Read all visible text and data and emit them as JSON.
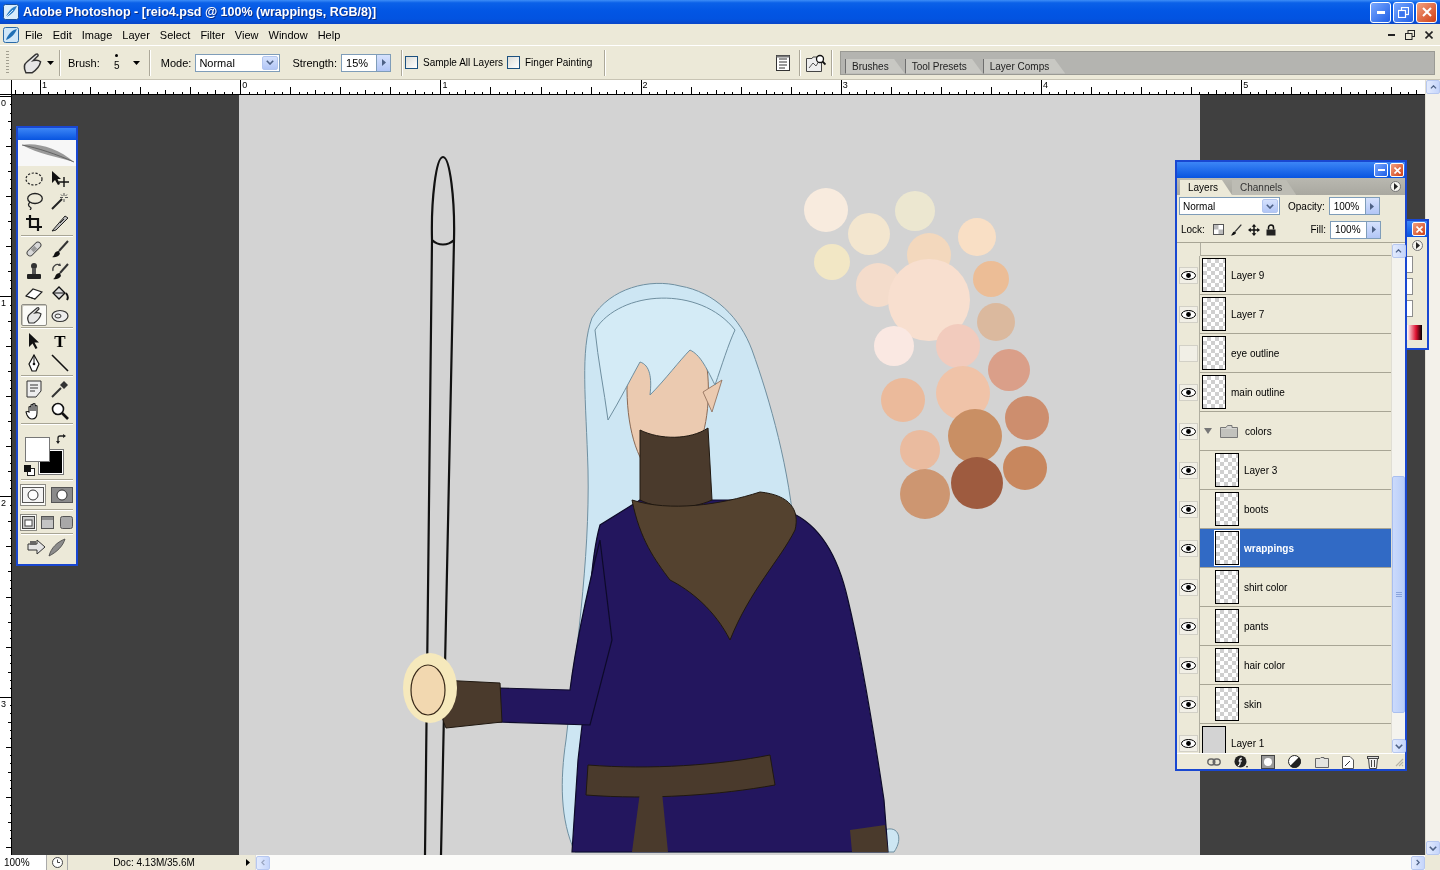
{
  "window": {
    "title": "Adobe Photoshop - [reio4.psd @ 100% (wrappings, RGB/8)]"
  },
  "menu_bar": {
    "items": [
      "File",
      "Edit",
      "Image",
      "Layer",
      "Select",
      "Filter",
      "View",
      "Window",
      "Help"
    ]
  },
  "options_bar": {
    "brush_label": "Brush:",
    "brush_size": "5",
    "mode_label": "Mode:",
    "mode": "Normal",
    "strength_label": "Strength:",
    "strength": "15%",
    "checkboxes": [
      {
        "label": "Sample All Layers",
        "checked": false
      },
      {
        "label": "Finger Painting",
        "checked": false
      }
    ],
    "palette_well_tabs": [
      "Brushes",
      "Tool Presets",
      "Layer Comps"
    ]
  },
  "rulers": {
    "horizontal": [
      "1",
      "0",
      "1",
      "2",
      "3",
      "4",
      "5"
    ],
    "vertical": [
      "0",
      "1",
      "2",
      "3"
    ]
  },
  "toolbox": {
    "tool_groups": [
      [
        {
          "kind": "marquee",
          "selected": false
        },
        {
          "kind": "move",
          "selected": false
        },
        {
          "kind": "lasso",
          "selected": false
        },
        {
          "kind": "magic_wand",
          "selected": false
        },
        {
          "kind": "crop",
          "selected": false
        },
        {
          "kind": "slice",
          "selected": false
        }
      ],
      [
        {
          "kind": "healing_brush",
          "selected": false
        },
        {
          "kind": "brush",
          "selected": false
        },
        {
          "kind": "clone_stamp",
          "selected": false
        },
        {
          "kind": "history_brush",
          "selected": false
        },
        {
          "kind": "eraser",
          "selected": false
        },
        {
          "kind": "paint_bucket",
          "selected": false
        },
        {
          "kind": "smudge",
          "selected": true
        },
        {
          "kind": "sponge",
          "selected": false
        }
      ],
      [
        {
          "kind": "path_selection",
          "selected": false
        },
        {
          "kind": "type",
          "glyph": "T",
          "selected": false
        },
        {
          "kind": "pen",
          "selected": false
        },
        {
          "kind": "line",
          "selected": false
        }
      ],
      [
        {
          "kind": "notes",
          "selected": false
        },
        {
          "kind": "eyedropper",
          "selected": false
        },
        {
          "kind": "hand",
          "selected": false
        },
        {
          "kind": "zoom",
          "selected": false
        }
      ]
    ],
    "mask_modes": [
      {
        "kind": "standard",
        "selected": true
      },
      {
        "kind": "quick_mask",
        "selected": false
      }
    ],
    "screen_modes": [
      {
        "kind": "standard",
        "selected": true
      },
      {
        "kind": "full_with_menu",
        "selected": false
      },
      {
        "kind": "full",
        "selected": false
      }
    ]
  },
  "canvas": {
    "paint_dabs": [
      {
        "color": "#f8ebde"
      },
      {
        "color": "#f3e6cf"
      },
      {
        "color": "#ece7d0"
      },
      {
        "color": "#f2e7c5"
      },
      {
        "color": "#f9dfc5"
      },
      {
        "color": "#f3d8bd"
      },
      {
        "color": "#f4dccb"
      },
      {
        "color": "#ecbd96"
      },
      {
        "color": "#f8dfcf"
      },
      {
        "color": "#dbb99e"
      },
      {
        "color": "#fae8e2"
      },
      {
        "color": "#f2cbbd"
      },
      {
        "color": "#da9f89"
      },
      {
        "color": "#ebba9b"
      },
      {
        "color": "#f0c3a8"
      },
      {
        "color": "#cd8e6e"
      },
      {
        "color": "#eabb9f"
      },
      {
        "color": "#c98f64"
      },
      {
        "color": "#c8875e"
      },
      {
        "color": "#cd9671"
      },
      {
        "color": "#9e5b3f"
      }
    ]
  },
  "layers_palette": {
    "tabs": [
      {
        "label": "Layers",
        "selected": true
      },
      {
        "label": "Channels",
        "selected": false
      }
    ],
    "blend_mode": "Normal",
    "opacity_label": "Opacity:",
    "opacity": "100%",
    "lock_label": "Lock:",
    "fill_label": "Fill:",
    "fill": "100%",
    "layers": [
      {
        "name": "Layer 9",
        "kind": "layer",
        "visible": true,
        "selected": false
      },
      {
        "name": "Layer 7",
        "kind": "layer",
        "visible": true,
        "selected": false
      },
      {
        "name": "eye outline",
        "kind": "layer",
        "visible": false,
        "selected": false
      },
      {
        "name": "main outline",
        "kind": "layer",
        "visible": true,
        "selected": false
      },
      {
        "name": "colors",
        "kind": "group",
        "visible": true,
        "expanded": true,
        "selected": false,
        "children": [
          {
            "name": "Layer 3",
            "kind": "layer",
            "visible": true,
            "selected": false
          },
          {
            "name": "boots",
            "kind": "layer",
            "visible": true,
            "selected": false
          },
          {
            "name": "wrappings",
            "kind": "layer",
            "visible": true,
            "selected": true
          },
          {
            "name": "shirt color",
            "kind": "layer",
            "visible": true,
            "selected": false
          },
          {
            "name": "pants",
            "kind": "layer",
            "visible": true,
            "selected": false
          },
          {
            "name": "hair color",
            "kind": "layer",
            "visible": true,
            "selected": false
          },
          {
            "name": "skin",
            "kind": "layer",
            "visible": true,
            "selected": false
          }
        ]
      },
      {
        "name": "Layer 1",
        "kind": "solid",
        "visible": true,
        "selected": false
      }
    ]
  },
  "status_bar": {
    "zoom": "100%",
    "doc_info": "Doc: 4.13M/35.6M"
  }
}
